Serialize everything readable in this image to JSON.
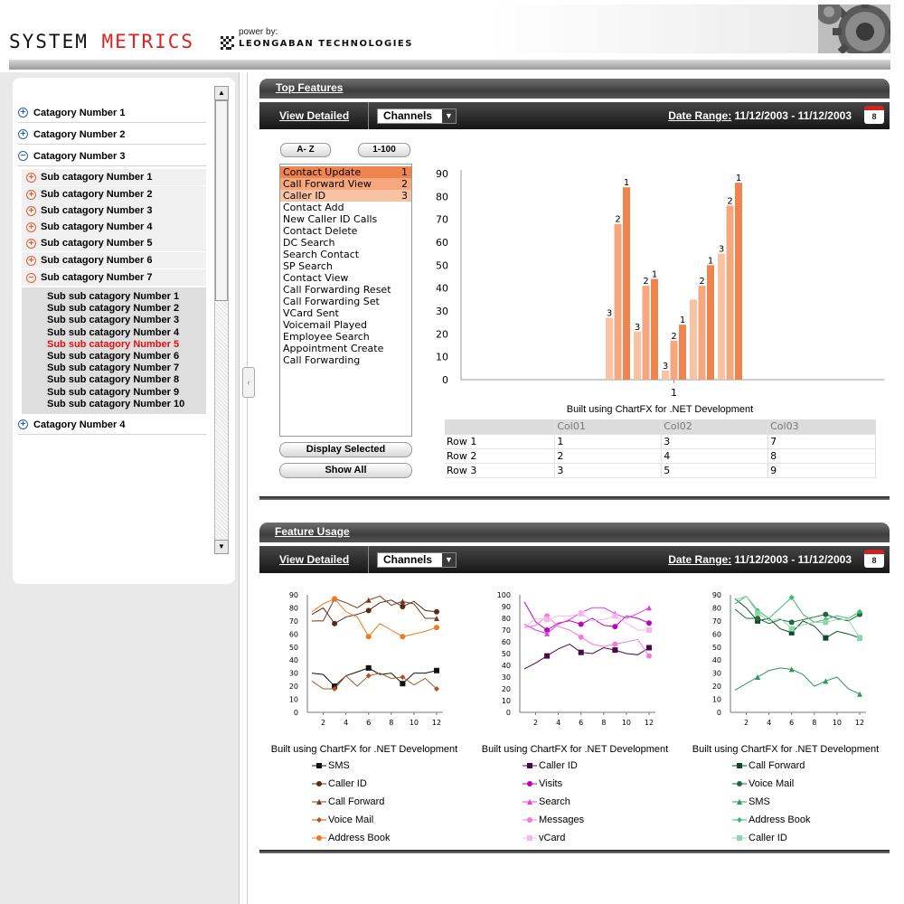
{
  "header": {
    "logo_part1": "SYSTEM ",
    "logo_part2": "METRICS",
    "powered_by": "power by:",
    "company": "LEONGABAN TECHNOLOGIES"
  },
  "tree": {
    "categories": [
      "Catagory Number 1",
      "Catagory Number 2",
      "Catagory Number 3",
      "Catagory Number 4"
    ],
    "subcategories": [
      "Sub catagory Number 1",
      "Sub catagory Number 2",
      "Sub catagory Number 3",
      "Sub catagory Number 4",
      "Sub catagory Number 5",
      "Sub catagory Number 6",
      "Sub catagory Number 7"
    ],
    "subsubcategories": [
      "Sub sub catagory Number 1",
      "Sub sub catagory Number 2",
      "Sub sub catagory Number 3",
      "Sub sub catagory Number 4",
      "Sub sub catagory Number 5",
      "Sub sub catagory Number 6",
      "Sub sub catagory Number 7",
      "Sub sub catagory Number 8",
      "Sub sub catagory Number 9",
      "Sub sub catagory Number 10"
    ],
    "selected_subsub": "Sub sub catagory Number 5"
  },
  "top_features": {
    "title": "Top Features",
    "view_detailed": "View Detailed",
    "channel": "Channels",
    "date_range_label": "Date Range:",
    "date_range_value": " 11/12/2003 - 11/12/2003",
    "calendar_day": "8",
    "sort_az": "A- Z",
    "sort_num": "1-100",
    "features": [
      {
        "name": "Contact Update",
        "rank": "1"
      },
      {
        "name": "Call Forward View",
        "rank": "2"
      },
      {
        "name": "Caller ID",
        "rank": "3"
      },
      {
        "name": "Contact Add",
        "rank": ""
      },
      {
        "name": "New Caller ID Calls",
        "rank": ""
      },
      {
        "name": "Contact Delete",
        "rank": ""
      },
      {
        "name": "DC Search",
        "rank": ""
      },
      {
        "name": "Search Contact",
        "rank": ""
      },
      {
        "name": "SP Search",
        "rank": ""
      },
      {
        "name": "Contact View",
        "rank": ""
      },
      {
        "name": "Call Forwarding Reset",
        "rank": ""
      },
      {
        "name": "Call Forwarding Set",
        "rank": ""
      },
      {
        "name": "VCard Sent",
        "rank": ""
      },
      {
        "name": "Voicemail Played",
        "rank": ""
      },
      {
        "name": "Employee Search",
        "rank": ""
      },
      {
        "name": "Appointment Create",
        "rank": ""
      },
      {
        "name": "Call Forwarding",
        "rank": ""
      }
    ],
    "display_selected": "Display Selected",
    "show_all": "Show All",
    "chart_caption": "Built using ChartFX for .NET Development",
    "table": {
      "headers": [
        "",
        "Col01",
        "Col02",
        "Col03"
      ],
      "rows": [
        [
          "Row 1",
          "1",
          "3",
          "7"
        ],
        [
          "Row 2",
          "2",
          "4",
          "8"
        ],
        [
          "Row 3",
          "3",
          "5",
          "9"
        ]
      ]
    }
  },
  "feature_usage": {
    "title": "Feature Usage",
    "view_detailed": "View Detailed",
    "channel": "Channels",
    "date_range_label": "Date Range:",
    "date_range_value": " 11/12/2003 - 11/12/2003",
    "calendar_day": "8",
    "caption": "Built using ChartFX for .NET Development"
  },
  "chart_data": [
    {
      "type": "bar",
      "categories": [
        "1"
      ],
      "ylim": [
        0,
        90
      ],
      "yticks": [
        0,
        10,
        20,
        30,
        40,
        50,
        60,
        70,
        80,
        90
      ],
      "groups": [
        {
          "bars": [
            {
              "value": 27,
              "label": "3"
            },
            {
              "value": 68,
              "label": "2"
            },
            {
              "value": 84,
              "label": "1"
            }
          ]
        },
        {
          "bars": [
            {
              "value": 21,
              "label": "3"
            },
            {
              "value": 41,
              "label": "2"
            },
            {
              "value": 44,
              "label": "1"
            }
          ]
        },
        {
          "bars": [
            {
              "value": 4,
              "label": "3"
            },
            {
              "value": 17,
              "label": "2"
            },
            {
              "value": 24,
              "label": "1"
            }
          ]
        },
        {
          "bars": [
            {
              "value": 35,
              "label": ""
            },
            {
              "value": 41,
              "label": "2"
            },
            {
              "value": 50,
              "label": "1"
            }
          ]
        },
        {
          "bars": [
            {
              "value": 55,
              "label": "3"
            },
            {
              "value": 76,
              "label": "2"
            },
            {
              "value": 86,
              "label": "1"
            }
          ]
        }
      ],
      "colors": [
        "#f8c3a2",
        "#f6a77d",
        "#f0844f"
      ],
      "caption": "Built using ChartFX for .NET Development"
    },
    {
      "type": "line",
      "x": [
        1,
        2,
        3,
        4,
        5,
        6,
        7,
        8,
        9,
        10,
        11,
        12
      ],
      "ylim": [
        0,
        90
      ],
      "yticks": [
        0,
        10,
        20,
        30,
        40,
        50,
        60,
        70,
        80,
        90
      ],
      "xticks": [
        2,
        4,
        6,
        8,
        10,
        12
      ],
      "series": [
        {
          "name": "SMS",
          "color": "#111111",
          "marker": "square",
          "values": [
            30,
            29,
            20,
            28,
            31,
            34,
            29,
            30,
            22,
            30,
            30,
            32
          ]
        },
        {
          "name": "Caller ID",
          "color": "#5a2a12",
          "marker": "circle",
          "values": [
            75,
            80,
            68,
            73,
            75,
            78,
            84,
            86,
            81,
            85,
            78,
            77
          ]
        },
        {
          "name": "Call Forward",
          "color": "#7a3a1a",
          "marker": "triangle",
          "values": [
            70,
            70,
            87,
            84,
            80,
            86,
            89,
            82,
            85,
            83,
            72,
            72
          ]
        },
        {
          "name": "Voice Mail",
          "color": "#b0521f",
          "marker": "diamond",
          "values": [
            24,
            18,
            18,
            28,
            20,
            28,
            30,
            26,
            27,
            21,
            26,
            18
          ]
        },
        {
          "name": "Address Book",
          "color": "#f07820",
          "marker": "circle",
          "values": [
            77,
            83,
            87,
            77,
            73,
            58,
            68,
            63,
            58,
            60,
            62,
            65
          ]
        }
      ]
    },
    {
      "type": "line",
      "x": [
        1,
        2,
        3,
        4,
        5,
        6,
        7,
        8,
        9,
        10,
        11,
        12
      ],
      "ylim": [
        0,
        100
      ],
      "yticks": [
        0,
        10,
        20,
        30,
        40,
        50,
        60,
        70,
        80,
        90,
        100
      ],
      "xticks": [
        2,
        4,
        6,
        8,
        10,
        12
      ],
      "series": [
        {
          "name": "Caller ID",
          "color": "#4a0a4a",
          "marker": "square",
          "values": [
            37,
            42,
            48,
            54,
            58,
            51,
            50,
            55,
            53,
            50,
            49,
            55
          ]
        },
        {
          "name": "Visits",
          "color": "#c000c0",
          "marker": "circle",
          "values": [
            94,
            77,
            70,
            76,
            78,
            75,
            80,
            74,
            73,
            82,
            80,
            76
          ]
        },
        {
          "name": "Search",
          "color": "#e040e0",
          "marker": "triangle",
          "values": [
            75,
            70,
            67,
            75,
            79,
            85,
            89,
            89,
            84,
            80,
            84,
            89
          ]
        },
        {
          "name": "Messages",
          "color": "#f07ae0",
          "marker": "circle",
          "values": [
            72,
            74,
            82,
            73,
            70,
            64,
            58,
            56,
            58,
            60,
            62,
            48
          ]
        },
        {
          "name": "vCard",
          "color": "#f6b6ec",
          "marker": "square",
          "values": [
            72,
            80,
            79,
            82,
            82,
            84,
            78,
            79,
            82,
            76,
            70,
            70
          ]
        }
      ]
    },
    {
      "type": "line",
      "x": [
        1,
        2,
        3,
        4,
        5,
        6,
        7,
        8,
        9,
        10,
        11,
        12
      ],
      "ylim": [
        0,
        90
      ],
      "yticks": [
        0,
        10,
        20,
        30,
        40,
        50,
        60,
        70,
        80,
        90
      ],
      "xticks": [
        2,
        4,
        6,
        8,
        10,
        12
      ],
      "series": [
        {
          "name": "Call Forward",
          "color": "#0e4a2a",
          "marker": "square",
          "values": [
            87,
            80,
            70,
            72,
            64,
            61,
            70,
            66,
            57,
            62,
            60,
            57
          ]
        },
        {
          "name": "Voice Mail",
          "color": "#1a6a3a",
          "marker": "circle",
          "values": [
            79,
            72,
            72,
            68,
            71,
            69,
            71,
            73,
            75,
            72,
            70,
            75
          ]
        },
        {
          "name": "SMS",
          "color": "#2a9a5a",
          "marker": "triangle",
          "values": [
            17,
            22,
            27,
            32,
            34,
            33,
            29,
            20,
            24,
            27,
            18,
            14
          ]
        },
        {
          "name": "Address Book",
          "color": "#3ab870",
          "marker": "diamond",
          "values": [
            83,
            89,
            78,
            72,
            80,
            88,
            75,
            69,
            71,
            74,
            72,
            77
          ]
        },
        {
          "name": "Caller ID",
          "color": "#8ad8a8",
          "marker": "square",
          "values": [
            86,
            89,
            76,
            70,
            72,
            64,
            67,
            69,
            69,
            71,
            71,
            57
          ]
        }
      ]
    }
  ]
}
